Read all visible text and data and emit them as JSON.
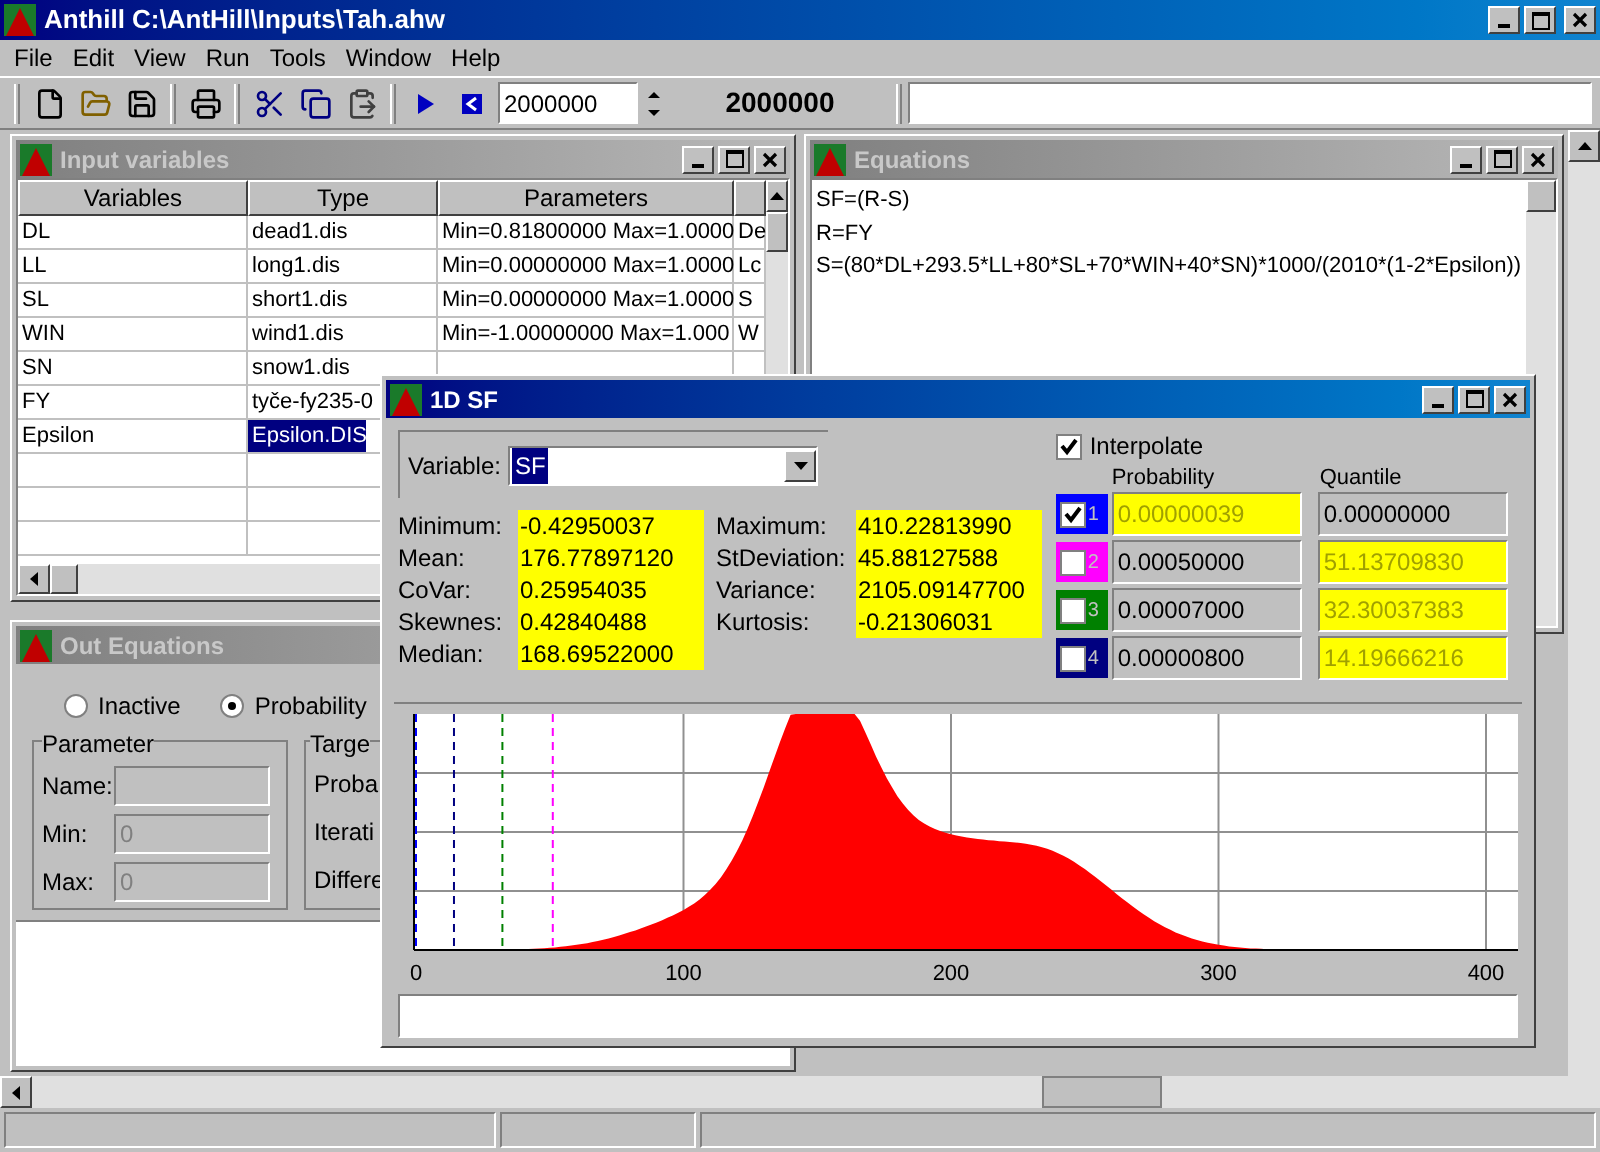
{
  "window": {
    "title": "Anthill C:\\AntHill\\Inputs\\Tah.ahw"
  },
  "menu": [
    "File",
    "Edit",
    "View",
    "Run",
    "Tools",
    "Window",
    "Help"
  ],
  "toolbar": {
    "iterations_field": {
      "value": "2000000"
    },
    "iterations_display": "2000000"
  },
  "input_variables": {
    "title": "Input variables",
    "columns": [
      "Variables",
      "Type",
      "Parameters"
    ],
    "rows": [
      {
        "cells": [
          "DL",
          "dead1.dis",
          "Min=0.81800000 Max=1.0000",
          "De"
        ],
        "selected": false
      },
      {
        "cells": [
          "LL",
          "long1.dis",
          "Min=0.00000000 Max=1.0000",
          "Lc"
        ],
        "selected": false
      },
      {
        "cells": [
          "SL",
          "short1.dis",
          "Min=0.00000000 Max=1.0000",
          "S"
        ],
        "selected": false
      },
      {
        "cells": [
          "WIN",
          "wind1.dis",
          "Min=-1.00000000 Max=1.000",
          "W"
        ],
        "selected": false
      },
      {
        "cells": [
          "SN",
          "snow1.dis"
        ],
        "selected": false
      },
      {
        "cells": [
          "FY",
          "tyče-fy235-0"
        ],
        "selected": false
      },
      {
        "cells": [
          "Epsilon",
          "Epsilon.DIS"
        ],
        "selected": true
      }
    ]
  },
  "equations": {
    "title": "Equations",
    "lines": [
      "SF=(R-S)",
      "R=FY",
      "S=(80*DL+293.5*LL+80*SL+70*WIN+40*SN)*1000/(2010*(1-2*Epsilon))"
    ]
  },
  "out_equations": {
    "title": "Out Equations",
    "modes": [
      {
        "label": "Inactive",
        "selected": false
      },
      {
        "label": "Probability",
        "selected": true
      }
    ],
    "parameter": {
      "title": "Parameter",
      "fields": [
        {
          "label": "Name:",
          "disabled": true
        },
        {
          "label": "Min:",
          "value": "0",
          "disabled": true
        },
        {
          "label": "Max:",
          "value": "0",
          "disabled": true
        }
      ]
    },
    "target": {
      "title": "Targe",
      "labels": [
        "Proba",
        "Iterati",
        "Differe"
      ]
    }
  },
  "dialog": {
    "title": "1D SF",
    "variable": {
      "label": "Variable:",
      "value": "SF"
    },
    "stats_left": [
      {
        "label": "Minimum:",
        "value": "-0.42950037"
      },
      {
        "label": "Mean:",
        "value": "176.77897120"
      },
      {
        "label": "CoVar:",
        "value": "0.25954035"
      },
      {
        "label": "Skewnes:",
        "value": "0.42840488"
      },
      {
        "label": "Median:",
        "value": "168.69522000"
      }
    ],
    "stats_right": [
      {
        "label": "Maximum:",
        "value": "410.22813990"
      },
      {
        "label": "StDeviation:",
        "value": "45.88127588"
      },
      {
        "label": "Variance:",
        "value": "2105.09147700"
      },
      {
        "label": "Kurtosis:",
        "value": "-0.21306031"
      }
    ],
    "interpolate": {
      "label": "Interpolate",
      "checked": true
    },
    "headers": [
      "Probability",
      "Quantile"
    ],
    "points": [
      {
        "number": "1",
        "color": "#0000ff",
        "checked": true,
        "probability": "0.00000039",
        "quantile": "0.00000000",
        "quantile_highlighted": false
      },
      {
        "number": "2",
        "color": "#ff00ff",
        "checked": false,
        "probability": "0.00050000",
        "quantile": "51.13709830",
        "quantile_highlighted": true
      },
      {
        "number": "3",
        "color": "#008000",
        "checked": false,
        "probability": "0.00007000",
        "quantile": "32.30037383",
        "quantile_highlighted": true
      },
      {
        "number": "4",
        "color": "#000080",
        "checked": false,
        "probability": "0.00000800",
        "quantile": "14.19666216",
        "quantile_highlighted": true
      }
    ],
    "histogram": {
      "x_tick_labels": [
        "0",
        "100",
        "200",
        "300",
        "400"
      ]
    }
  }
}
